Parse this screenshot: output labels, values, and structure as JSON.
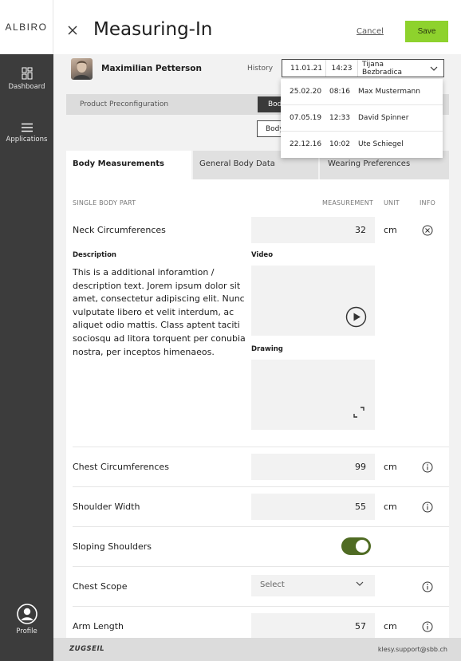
{
  "brand": "ALBIRO",
  "sidebar": {
    "items": [
      {
        "label": "Dashboard",
        "icon": "dashboard-icon"
      },
      {
        "label": "Applications",
        "icon": "menu-icon"
      }
    ],
    "profile": {
      "label": "Profile",
      "icon": "profile-icon"
    }
  },
  "header": {
    "title": "Measuring-In",
    "cancel_label": "Cancel",
    "save_label": "Save",
    "accent": "#8ed22d"
  },
  "patient": {
    "name": "Maximilian Petterson",
    "history_label": "History",
    "history_selected": {
      "date": "11.01.21",
      "time": "14:23",
      "name": "Tijana Bezbradica"
    }
  },
  "history_options": [
    {
      "date": "25.02.20",
      "time": "08:16",
      "name": "Max Mustermann"
    },
    {
      "date": "07.05.19",
      "time": "12:33",
      "name": "David Spinner"
    },
    {
      "date": "22.12.16",
      "time": "10:02",
      "name": "Ute Schiegel"
    }
  ],
  "config": {
    "label": "Product Preconfiguration",
    "dark_button": "Bod",
    "outline_button": "Body"
  },
  "tabs": [
    {
      "label": "Body Measurements"
    },
    {
      "label": "General Body Data"
    },
    {
      "label": "Wearing Preferences"
    }
  ],
  "table_headers": {
    "part": "SINGLE BODY PART",
    "measurement": "MEASUREMENT",
    "unit": "UNIT",
    "info": "INFO"
  },
  "rows": {
    "neck": {
      "label": "Neck Circumferences",
      "value": "32",
      "unit": "cm"
    },
    "chest": {
      "label": "Chest Circumferences",
      "value": "99",
      "unit": "cm"
    },
    "shoulder": {
      "label": "Shoulder Width",
      "value": "55",
      "unit": "cm"
    },
    "sloping": {
      "label": "Sloping Shoulders",
      "toggle_on": true,
      "toggle_color": "#4f6b23"
    },
    "chest_scope": {
      "label": "Chest Scope",
      "select_placeholder": "Select"
    },
    "arm": {
      "label": "Arm Length",
      "value": "57",
      "unit": "cm"
    }
  },
  "detail": {
    "description_title": "Description",
    "description_text": "This is a additional inforamtion / description text. Jorem ipsum dolor sit amet, consectetur adipiscing elit. Nunc vulputate libero et velit interdum, ac aliquet odio mattis. Class aptent taciti sociosqu ad litora torquent per conubia nostra, per inceptos himenaeos.",
    "video_title": "Video",
    "drawing_title": "Drawing"
  },
  "footer": {
    "logo": "ZUGSEIL",
    "email": "klesy.support@sbb.ch"
  }
}
